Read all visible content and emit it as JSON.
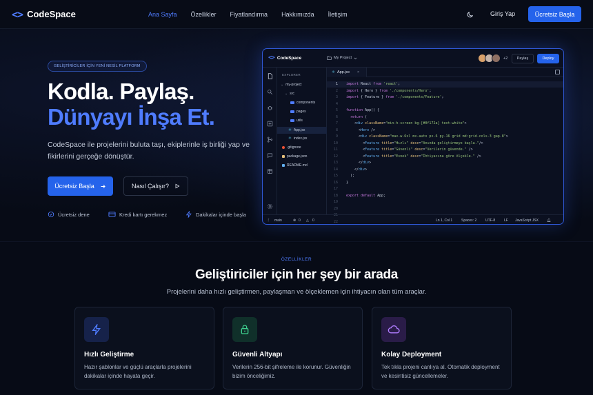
{
  "nav": {
    "brand": "CodeSpace",
    "brand_icon": "<>",
    "links": [
      "Ana Sayfa",
      "Özellikler",
      "Fiyatlandırma",
      "Hakkımızda",
      "İletişim"
    ],
    "login": "Giriş Yap",
    "cta": "Ücretsiz Başla"
  },
  "hero": {
    "badge": "GELİŞTİRİCİLER İÇİN YENİ NESİL PLATFORM",
    "title_line1": "Kodla. Paylaş.",
    "title_line2": "Dünyayı İnşa Et.",
    "lead": "CodeSpace ile projelerini buluta taşı, ekiplerinle iş birliği yap ve fikirlerini gerçeğe dönüştür.",
    "primary_cta": "Ücretsiz Başla",
    "secondary_cta": "Nasıl Çalışır?",
    "features": [
      "Ücretsiz dene",
      "Kredi kartı gerekmez",
      "Dakikalar içinde başla"
    ]
  },
  "editor": {
    "brand": "CodeSpace",
    "project": "My Project",
    "collaborators_extra": "+2",
    "share": "Paylaş",
    "deploy": "Deploy",
    "explorer_title": "EXPLORER",
    "tree": [
      {
        "label": "my-project",
        "kind": "folder",
        "depth": 0,
        "open": true
      },
      {
        "label": "src",
        "kind": "folder",
        "depth": 1,
        "open": true
      },
      {
        "label": "components",
        "kind": "folder",
        "depth": 2
      },
      {
        "label": "pages",
        "kind": "folder",
        "depth": 2
      },
      {
        "label": "utils",
        "kind": "folder",
        "depth": 2
      },
      {
        "label": "App.jsx",
        "kind": "jsx",
        "depth": 2,
        "selected": true
      },
      {
        "label": "index.jsx",
        "kind": "jsx",
        "depth": 2
      },
      {
        "label": ".gitignore",
        "kind": "git",
        "depth": 1
      },
      {
        "label": "package.json",
        "kind": "json",
        "depth": 1
      },
      {
        "label": "README.md",
        "kind": "md",
        "depth": 1
      }
    ],
    "tab": "App.jsx",
    "line_numbers": [
      "1",
      "2",
      "3",
      "4",
      "5",
      "6",
      "7",
      "8",
      "9",
      "10",
      "11",
      "12",
      "13",
      "14",
      "15",
      "16",
      "17",
      "18",
      "19",
      "20",
      "21",
      "22",
      "23"
    ],
    "code": [
      "import React from 'react';",
      "import { Hero } from './components/Hero';",
      "import { Feature } from './components/Feature';",
      "",
      "function App() {",
      "  return (",
      "    <div className=\"min-h-screen bg-[#0f172a] text-white\">",
      "      <Hero />",
      "      <div className=\"max-w-6xl mx-auto px-6 py-16 grid md:grid-cols-3 gap-8\">",
      "        <Feature title=\"Hızlı\" desc=\"Anında geliştirmeye başla.\"/>",
      "        <Feature title=\"Güvenli\" desc=\"Verilerin güvende.\" />",
      "        <Feature title=\"Esnek\" desc=\"İhtiyacına göre ölçekle.\" />",
      "      </div>",
      "    </div>",
      "  );",
      "}",
      "",
      "export default App;",
      "",
      "",
      "",
      "",
      ""
    ],
    "status": {
      "branch": "main",
      "errors": "0",
      "warnings": "0",
      "position": "Ln 1, Col 1",
      "spaces": "Spaces: 2",
      "encoding": "UTF-8",
      "eol": "LF",
      "language": "JavaScript JSX"
    }
  },
  "features_section": {
    "eyebrow": "ÖZELLİKLER",
    "title": "Geliştiriciler için her şey bir arada",
    "subtitle": "Projelerini daha hızlı geliştirmen, paylaşman ve ölçeklemen için ihtiyacın olan tüm araçlar.",
    "cards": [
      {
        "icon": "lightning-icon",
        "color": "#4f7cff",
        "bg": "#16224a",
        "title": "Hızlı Geliştirme",
        "desc": "Hazır şablonlar ve güçlü araçlarla projelerini dakikalar içinde hayata geçir."
      },
      {
        "icon": "lock-icon",
        "color": "#3ecf8e",
        "bg": "#10302a",
        "title": "Güvenli Altyapı",
        "desc": "Verilerin 256-bit şifreleme ile korunur. Güvenliğin bizim önceliğimiz."
      },
      {
        "icon": "cloud-icon",
        "color": "#b07cff",
        "bg": "#2a1c48",
        "title": "Kolay Deployment",
        "desc": "Tek tıkla projeni canlıya al. Otomatik deployment ve kesintisiz güncellemeler."
      }
    ]
  },
  "colors": {
    "accent": "#2563eb",
    "link_active": "#4f7cff",
    "background": "#070b16"
  }
}
